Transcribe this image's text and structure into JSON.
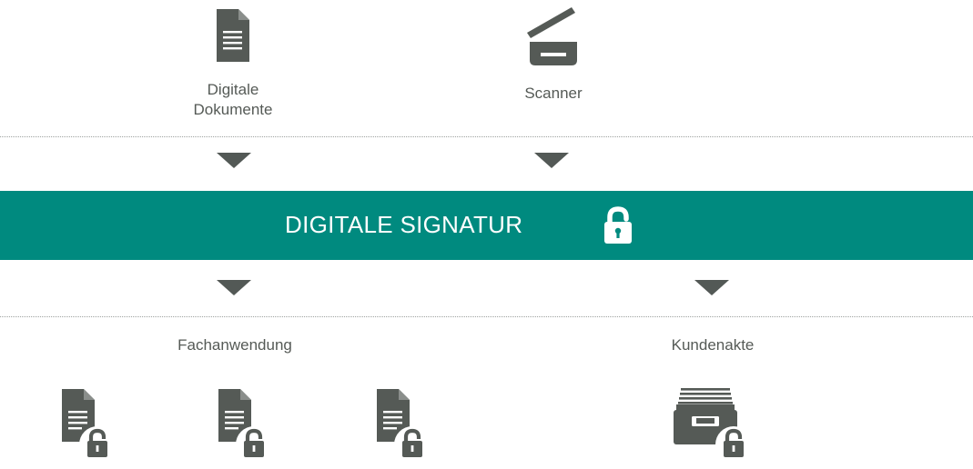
{
  "inputs": {
    "digital_documents_label_line1": "Digitale",
    "digital_documents_label_line2": "Dokumente",
    "scanner_label": "Scanner"
  },
  "signature_band": {
    "title": "DIGITALE SIGNATUR",
    "color": "#008a7f"
  },
  "outputs": {
    "fachanwendung_label": "Fachanwendung",
    "kundenakte_label": "Kundenakte"
  },
  "colors": {
    "icon": "#555a56",
    "arrow": "#535956",
    "text": "#555a56"
  },
  "icons": [
    "document-icon",
    "scanner-icon",
    "lock-icon",
    "signed-document-icon",
    "archive-drawer-icon"
  ]
}
